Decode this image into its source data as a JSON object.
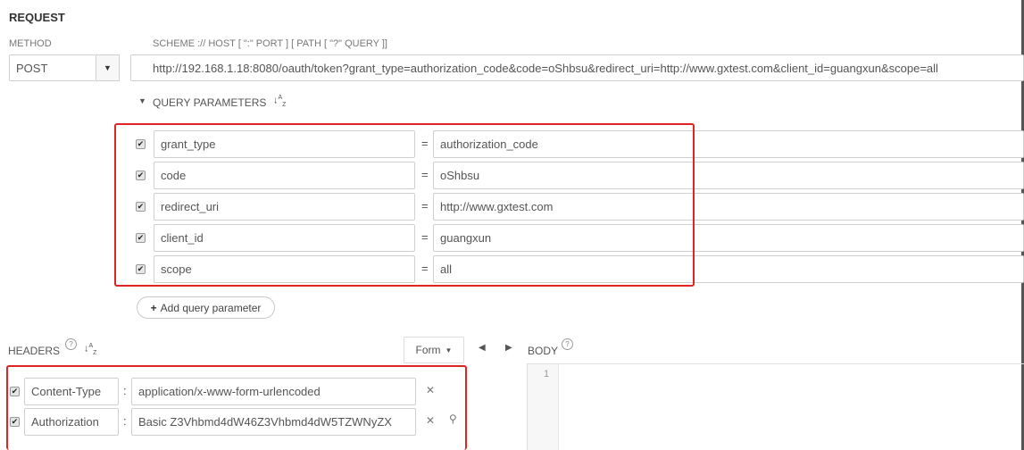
{
  "request": {
    "title": "REQUEST",
    "method_label": "METHOD",
    "method_value": "POST",
    "url_label": "SCHEME :// HOST [ \":\" PORT ] [ PATH [ \"?\" QUERY ]]",
    "url_value": "http://192.168.1.18:8080/oauth/token?grant_type=authorization_code&code=oShbsu&redirect_uri=http://www.gxtest.com&client_id=guangxun&scope=all"
  },
  "query": {
    "toggle_icon": "caret-down-icon",
    "title": "QUERY PARAMETERS",
    "sort_icon": "sort-az-icon",
    "params": [
      {
        "key": "grant_type",
        "value": "authorization_code",
        "checked": true
      },
      {
        "key": "code",
        "value": "oShbsu",
        "checked": true
      },
      {
        "key": "redirect_uri",
        "value": "http://www.gxtest.com",
        "checked": true
      },
      {
        "key": "client_id",
        "value": "guangxun",
        "checked": true
      },
      {
        "key": "scope",
        "value": "all",
        "checked": true
      }
    ],
    "separator": "=",
    "add_label": "Add query parameter"
  },
  "headers": {
    "title": "HEADERS",
    "help_icon": "help-circle-icon",
    "form_label": "Form",
    "items": [
      {
        "key": "Content-Type",
        "value": "application/x-www-form-urlencoded",
        "checked": true
      },
      {
        "key": "Authorization",
        "value": "Basic Z3Vhbmd4dW46Z3Vhbmd4dW5TZWNyZX",
        "checked": true
      }
    ],
    "separator": ":"
  },
  "body": {
    "title": "BODY",
    "line_number": "1"
  },
  "colors": {
    "highlight": "#e02424",
    "border": "#cfcfcf"
  }
}
